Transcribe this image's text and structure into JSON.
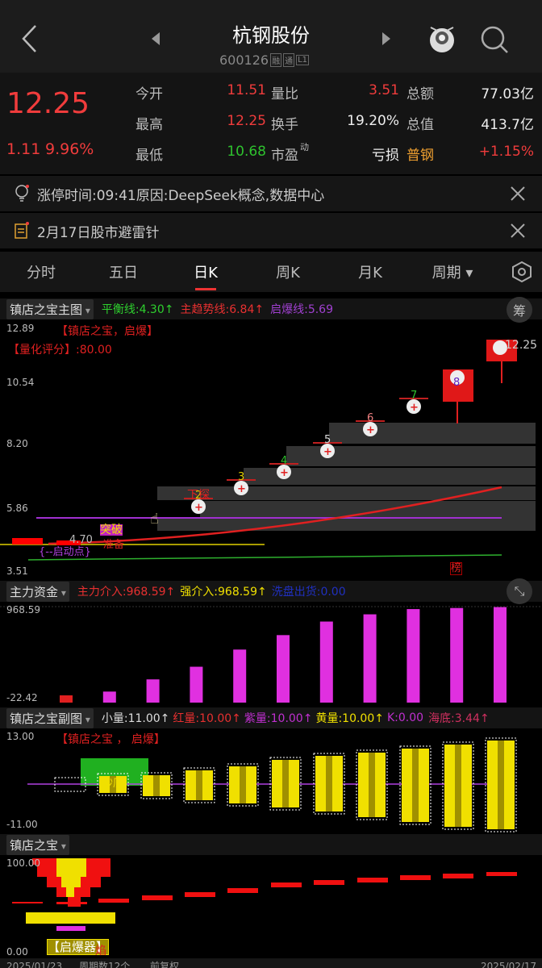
{
  "header": {
    "title": "杭钢股份",
    "code": "600126",
    "badges": [
      "融",
      "通",
      "L1"
    ]
  },
  "quote": {
    "price": "12.25",
    "change": "1.11",
    "pct": "9.96%",
    "rows": [
      [
        "今开",
        "11.51",
        "量比",
        "3.51",
        "总额",
        "77.03亿"
      ],
      [
        "最高",
        "12.25",
        "换手",
        "19.20%",
        "总值",
        "413.7亿"
      ],
      [
        "最低",
        "10.68",
        "市盈",
        "亏损",
        "普钢",
        "+1.15%"
      ]
    ],
    "pe_sup": "动"
  },
  "notices": [
    "涨停时间:09:41原因:DeepSeek概念,数据中心",
    "2月17日股市避雷针"
  ],
  "tabs": [
    "分时",
    "五日",
    "日K",
    "周K",
    "月K",
    "周期"
  ],
  "main": {
    "selector": "镇店之宝主图",
    "l1": "平衡线:4.30↑",
    "l2": "主趋势线:6.84↑",
    "l3": "启爆线:5.69",
    "chip": "筹",
    "ymax": "12.89",
    "y2": "10.54",
    "y3": "8.20",
    "y4": "5.86",
    "ymin": "3.51",
    "t1": "【镇店之宝，启爆】",
    "t2": "【量化评分】:80.00",
    "last": "12.25",
    "marks": [
      "2",
      "3",
      "4",
      "5",
      "6",
      "7",
      "8"
    ],
    "tan": "下探",
    "tupo": "突破",
    "qidong": "{--启动点}",
    "zhunbei": "准备",
    "val70": "4.70",
    "bang": "榜"
  },
  "money": {
    "selector": "主力资金",
    "l1": "主力介入:968.59↑",
    "l2": "强介入:968.59↑",
    "l3": "洗盘出货:0.00",
    "ymax": "968.59",
    "ymin": "-22.42",
    "values": [
      -20,
      55,
      190,
      330,
      520,
      680,
      830,
      910,
      968,
      980,
      990
    ]
  },
  "sub": {
    "selector": "镇店之宝副图",
    "l1": "小量:11.00↑",
    "l2": "红量:10.00↑",
    "l3": "紫量:10.00↑",
    "l4": "黄量:10.00↑",
    "l5": "K:0.00",
    "l6": "海底:3.44↑",
    "ymax": "13.00",
    "ymin": "-11.00",
    "t1": "【镇店之宝 ， 启爆】",
    "chaodi": "抄底"
  },
  "bottom": {
    "selector": "镇店之宝",
    "ymax": "100.00",
    "ymin": "0.00",
    "qbq": "【启爆器】",
    "yan": "焰"
  },
  "footer": {
    "start": "2025/01/23",
    "count": "周期数12个",
    "adj": "前复权",
    "end": "2025/02/17"
  },
  "colors": {
    "up": "#f03c3c",
    "down": "#2ec22e",
    "purple": "#b040e0",
    "yellow": "#f0e000",
    "magenta": "#e030e0"
  }
}
